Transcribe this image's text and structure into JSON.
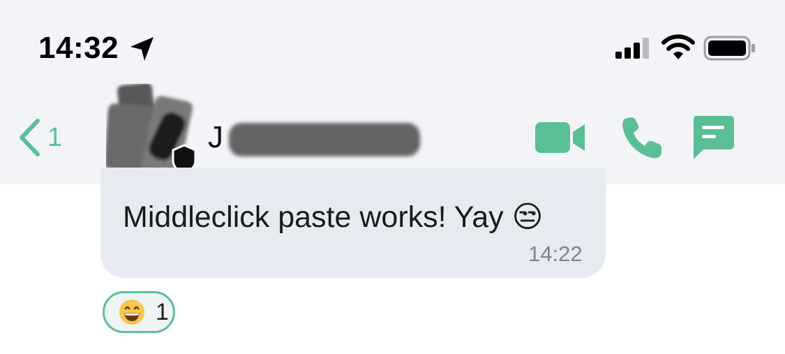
{
  "status_bar": {
    "time": "14:32",
    "location_icon": "location-arrow-icon",
    "signal_icon": "cellular-signal-icon",
    "wifi_icon": "wifi-icon",
    "battery_icon": "battery-icon"
  },
  "header": {
    "back_icon": "chevron-left-icon",
    "back_count": "1",
    "avatar": "contact-avatar",
    "contact_name": "J",
    "actions": {
      "video_icon": "video-camera-icon",
      "call_icon": "phone-icon",
      "chat_icon": "message-square-icon"
    }
  },
  "message": {
    "text": "Middleclick paste works! Yay 😒",
    "time": "14:22"
  },
  "reaction": {
    "emoji_icon": "grinning-face-emoji",
    "count": "1"
  },
  "colors": {
    "accent": "#5bbf95",
    "header_bg": "#f3f4f8",
    "bubble_bg": "#e7ebf1"
  }
}
